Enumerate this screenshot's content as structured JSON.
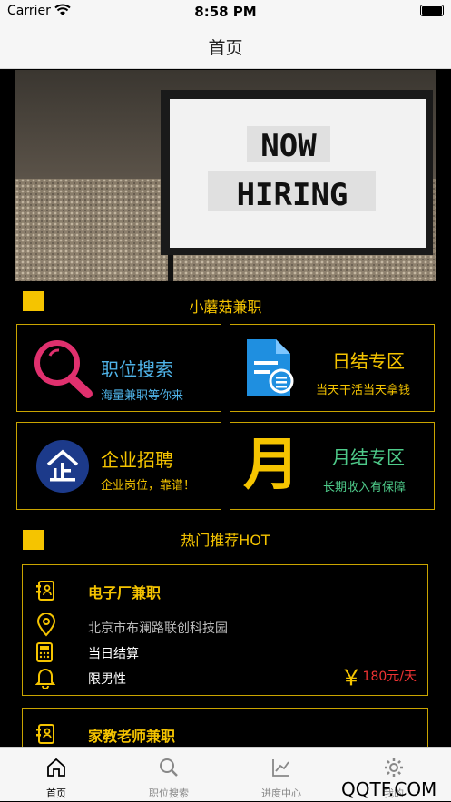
{
  "status_bar": {
    "carrier": "Carrier",
    "time": "8:58 PM"
  },
  "nav": {
    "title": "首页"
  },
  "hero": {
    "sign_line1": "NOW",
    "sign_line2": "HIRING"
  },
  "section1": {
    "title": "小蘑菇兼职"
  },
  "cards": [
    {
      "title": "职位搜索",
      "subtitle": "海量兼职等你来",
      "icon": "magnifier-icon",
      "title_color": "#4fb3e8",
      "subtitle_color": "#4fb3e8"
    },
    {
      "title": "日结专区",
      "subtitle": "当天干活当天拿钱",
      "icon": "document-icon",
      "title_color": "#f5c400",
      "subtitle_color": "#f5c400"
    },
    {
      "title": "企业招聘",
      "subtitle": "企业岗位，靠谱！",
      "icon": "enterprise-icon",
      "title_color": "#f5c400",
      "subtitle_color": "#f5c400"
    },
    {
      "title": "月结专区",
      "subtitle": "长期收入有保障",
      "icon": "month-icon",
      "icon_char": "月",
      "title_color": "#4ecb8a",
      "subtitle_color": "#4ecb8a"
    }
  ],
  "section2": {
    "title": "热门推荐HOT"
  },
  "jobs": [
    {
      "name": "电子厂兼职",
      "address": "北京市布澜路联创科技园",
      "settlement": "当日结算",
      "gender": "限男性",
      "price": "180元/天",
      "currency": "￥"
    },
    {
      "name": "家教老师兼职"
    }
  ],
  "tabs": [
    {
      "label": "首页",
      "icon": "home-icon",
      "active": true
    },
    {
      "label": "职位搜索",
      "icon": "search-icon",
      "active": false
    },
    {
      "label": "进度中心",
      "icon": "chart-icon",
      "active": false
    },
    {
      "label": "我的",
      "icon": "gear-icon",
      "active": false
    }
  ],
  "watermark": "QQTF.COM"
}
